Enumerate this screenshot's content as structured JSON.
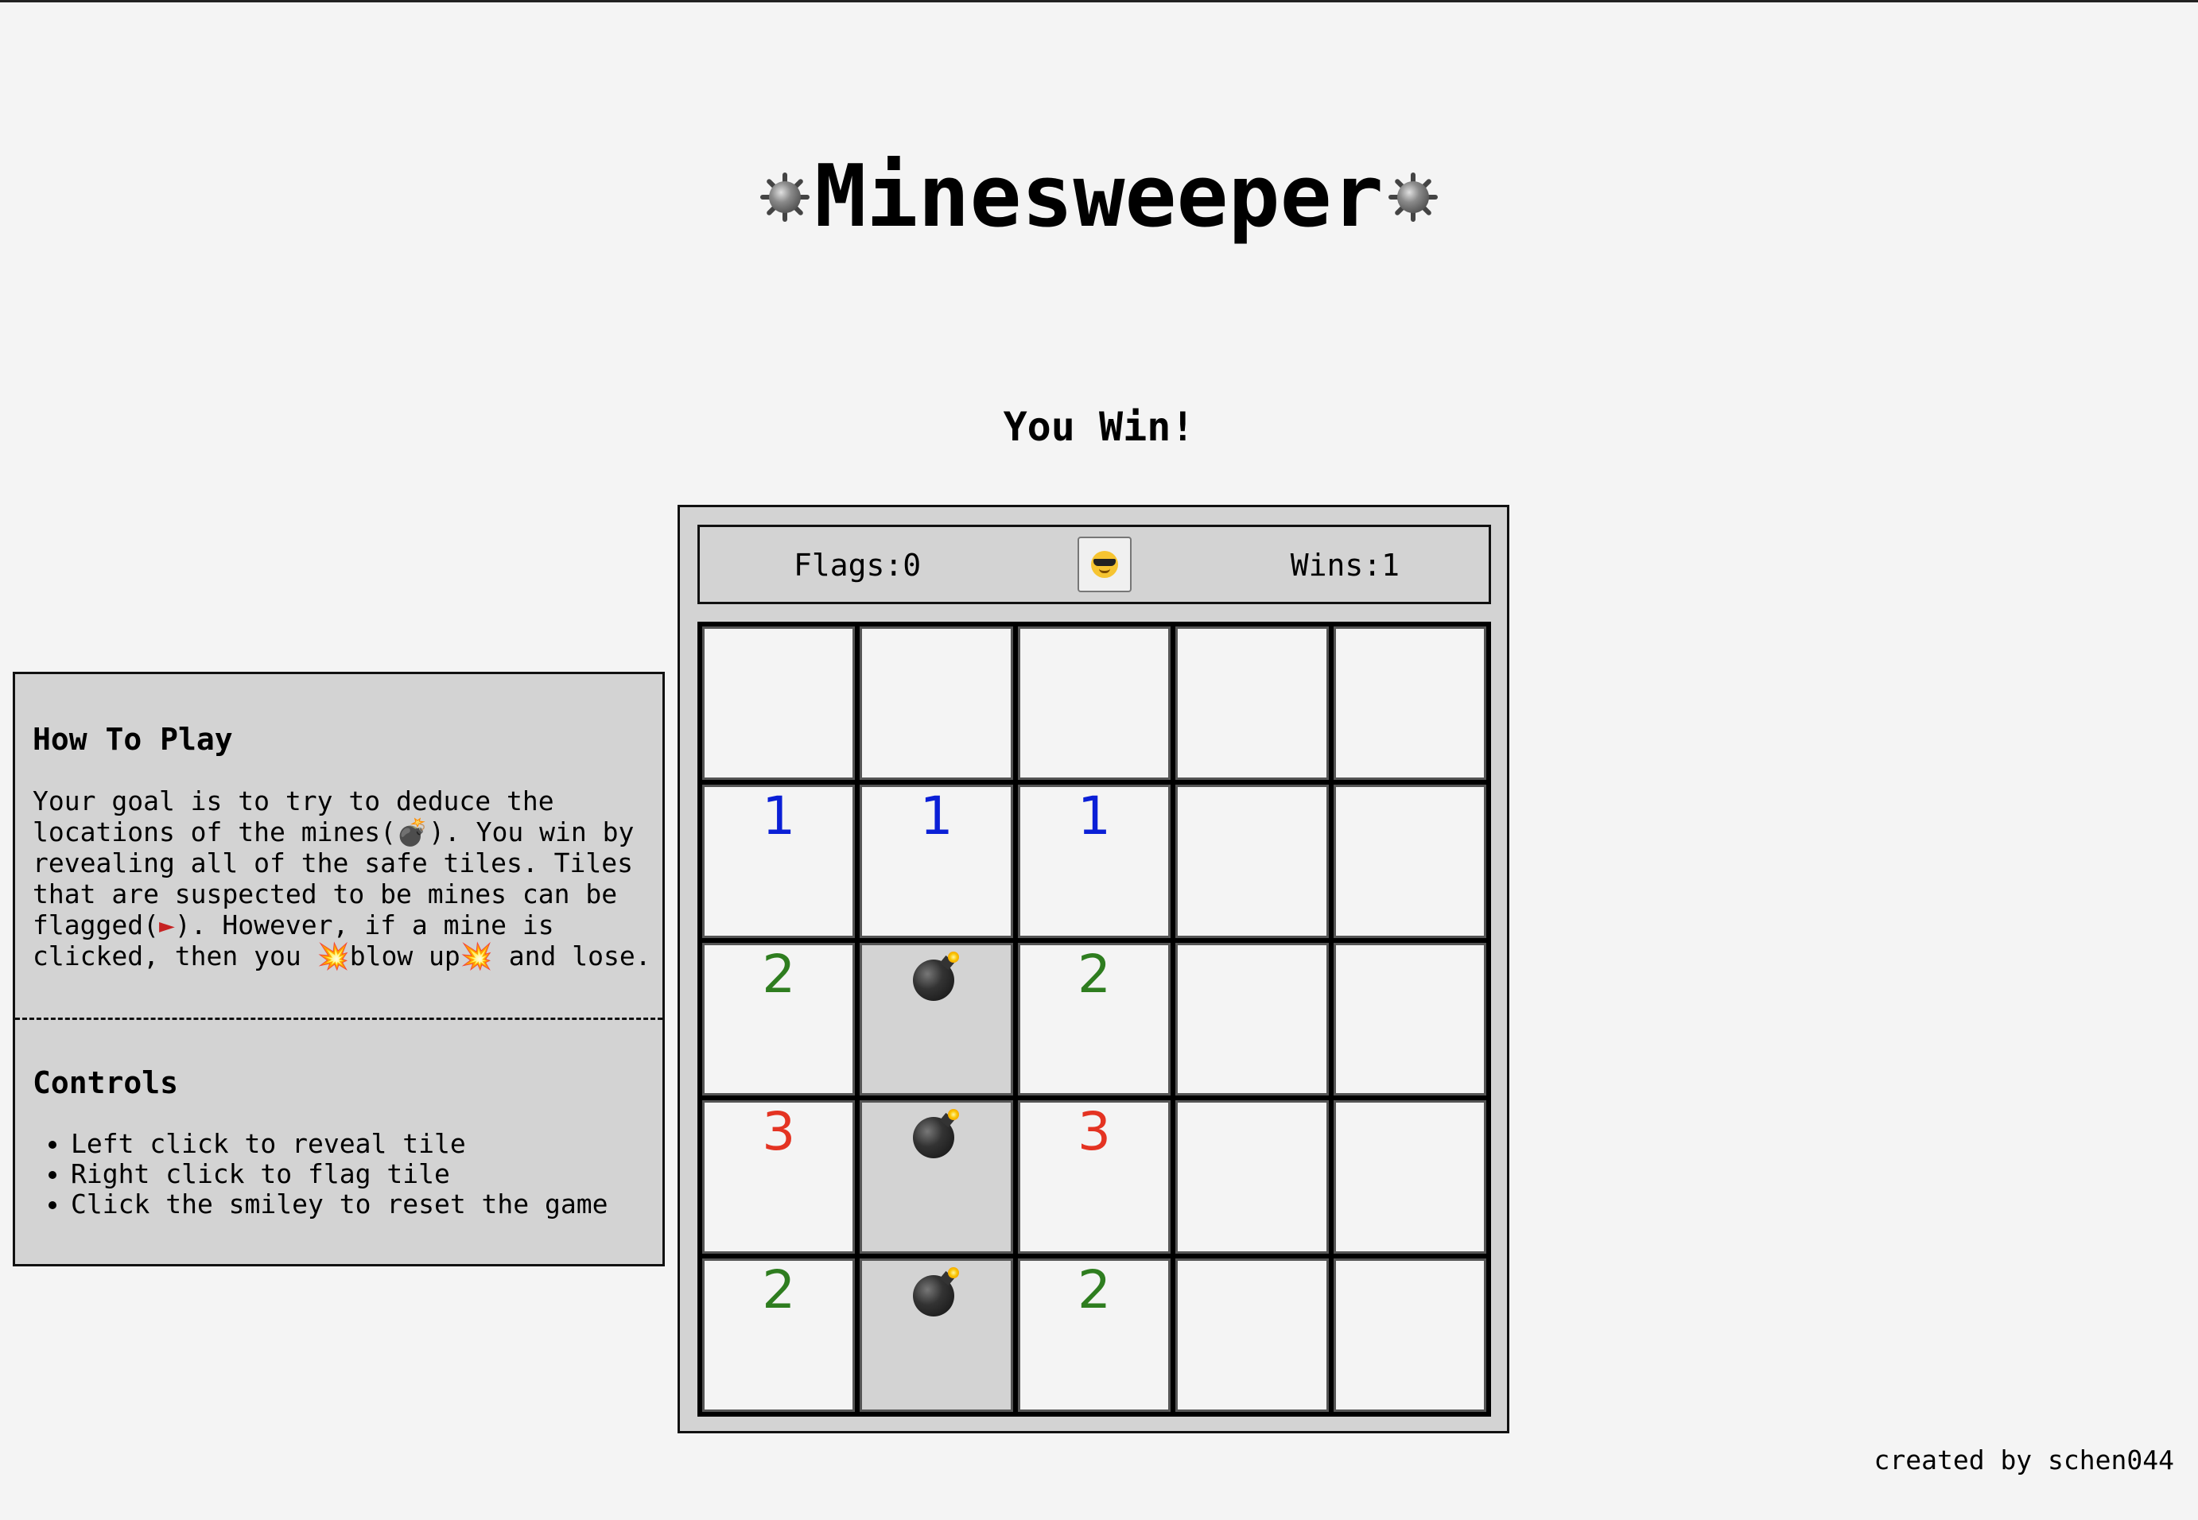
{
  "header": {
    "title": "Minesweeper",
    "title_icon": "naval-mine-icon"
  },
  "game": {
    "status": "You Win!",
    "flags_text": "Flags:0",
    "wins_text": "Wins:1",
    "reset_button_icon": "sunglasses-smiley-icon",
    "board": [
      [
        "",
        "",
        "",
        "",
        ""
      ],
      [
        "1",
        "1",
        "1",
        "",
        ""
      ],
      [
        "2",
        "mine",
        "2",
        "",
        ""
      ],
      [
        "3",
        "mine",
        "3",
        "",
        ""
      ],
      [
        "2",
        "mine",
        "2",
        "",
        ""
      ]
    ],
    "number_colors": {
      "1": "#0a1fd6",
      "2": "#2e7d1f",
      "3": "#e43322"
    }
  },
  "instructions": {
    "how_to_title": "How To Play",
    "how_to_text_1": "Your goal is to try to deduce the\nlocations of the mines(",
    "how_to_text_2": "). You win by\nrevealing all of the safe tiles. Tiles\nthat are suspected to be mines can be\nflagged(",
    "how_to_text_3": "). However, if a mine is\nclicked, then you ",
    "how_to_text_4": "blow up",
    "how_to_text_5": " and lose.",
    "controls_title": "Controls",
    "controls": [
      "Left click to reveal tile",
      "Right click to flag tile",
      "Click the smiley to reset the game"
    ]
  },
  "footer": {
    "credit": "created by schen044"
  }
}
